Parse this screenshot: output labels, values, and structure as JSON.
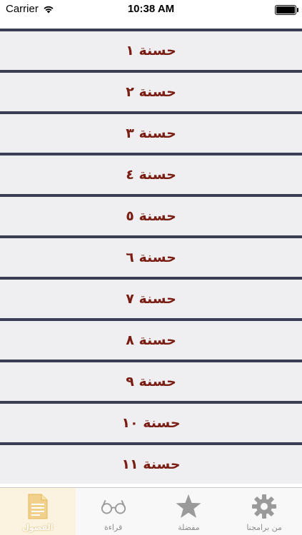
{
  "status_bar": {
    "carrier": "Carrier",
    "time": "10:38 AM"
  },
  "list": {
    "items": [
      {
        "label": "حسنة ١"
      },
      {
        "label": "حسنة ٢"
      },
      {
        "label": "حسنة ٣"
      },
      {
        "label": "حسنة ٤"
      },
      {
        "label": "حسنة ٥"
      },
      {
        "label": "حسنة ٦"
      },
      {
        "label": "حسنة ٧"
      },
      {
        "label": "حسنة ٨"
      },
      {
        "label": "حسنة ٩"
      },
      {
        "label": "حسنة ١٠"
      },
      {
        "label": "حسنة ١١"
      }
    ]
  },
  "tab_bar": {
    "tabs": [
      {
        "label": "الفصول",
        "icon": "document-icon",
        "active": true
      },
      {
        "label": "قراءة",
        "icon": "glasses-icon",
        "active": false
      },
      {
        "label": "مفضلة",
        "icon": "star-icon",
        "active": false
      },
      {
        "label": "من برامجنا",
        "icon": "gear-icon",
        "active": false
      }
    ]
  },
  "colors": {
    "row_background": "#efeff1",
    "row_separator": "#3b3e52",
    "label_text": "#7a1e14",
    "tab_inactive": "#9a9a9a",
    "tab_active_icon": "#f0d08a"
  }
}
